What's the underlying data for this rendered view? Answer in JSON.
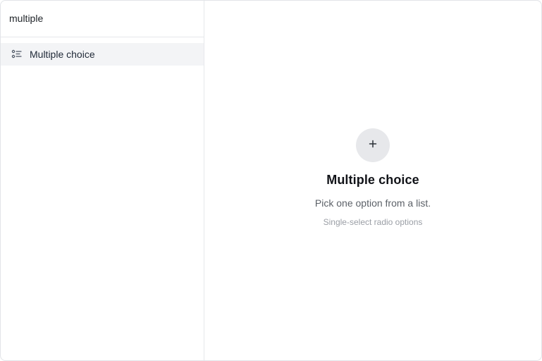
{
  "search": {
    "value": "multiple",
    "placeholder": ""
  },
  "results": [
    {
      "icon": "list-icon",
      "label": "Multiple choice"
    }
  ],
  "preview": {
    "add_icon": "plus-icon",
    "title": "Multiple choice",
    "description": "Pick one option from a list.",
    "hint": "Single-select radio options"
  },
  "colors": {
    "selected_row": "#f3f4f6",
    "icon_circle": "#e7e8eb",
    "border": "#e6e8eb"
  }
}
